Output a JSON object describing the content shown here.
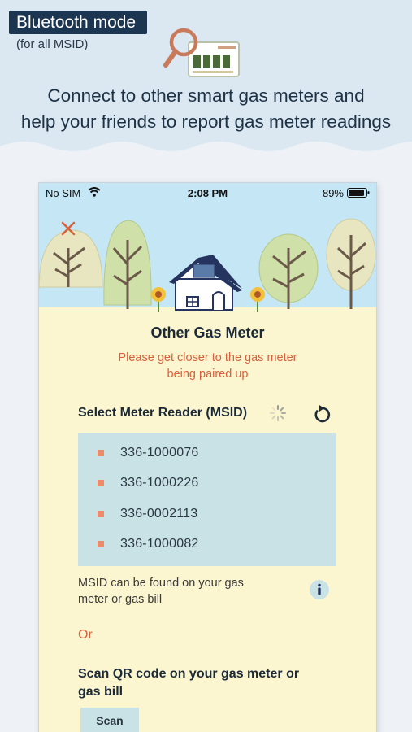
{
  "banner": {
    "mode": "Bluetooth mode",
    "mode_sub": "(for all MSID)",
    "tagline_1": "Connect to other smart gas meters and",
    "tagline_2": "help your friends to report gas meter readings"
  },
  "statusbar": {
    "carrier": "No SIM",
    "time": "2:08 PM",
    "battery": "89%"
  },
  "screen": {
    "title": "Other Gas Meter",
    "hint_1": "Please get closer to the gas meter",
    "hint_2": "being paired up",
    "select_label": "Select Meter Reader (MSID)",
    "msid_items": [
      "336-1000076",
      "336-1000226",
      "336-0002113",
      "336-1000082"
    ],
    "find_note_1": "MSID can be found on your gas",
    "find_note_2": "meter or gas bill",
    "or": "Or",
    "scan_label_1": "Scan QR code on your gas meter or",
    "scan_label_2": "gas bill",
    "scan_button": "Scan"
  },
  "icons": {
    "magnifier": "magnifier-icon",
    "meter": "gas-meter-icon",
    "close": "close-icon",
    "refresh": "refresh-icon",
    "info": "info-icon",
    "spinner": "loading-spinner-icon"
  },
  "colors": {
    "badge": "#1c3550",
    "accent_orange": "#d9603c",
    "list_bg": "#c9e2e6",
    "phone_bg": "#fcf6d0",
    "sky": "#c5e6f4"
  }
}
